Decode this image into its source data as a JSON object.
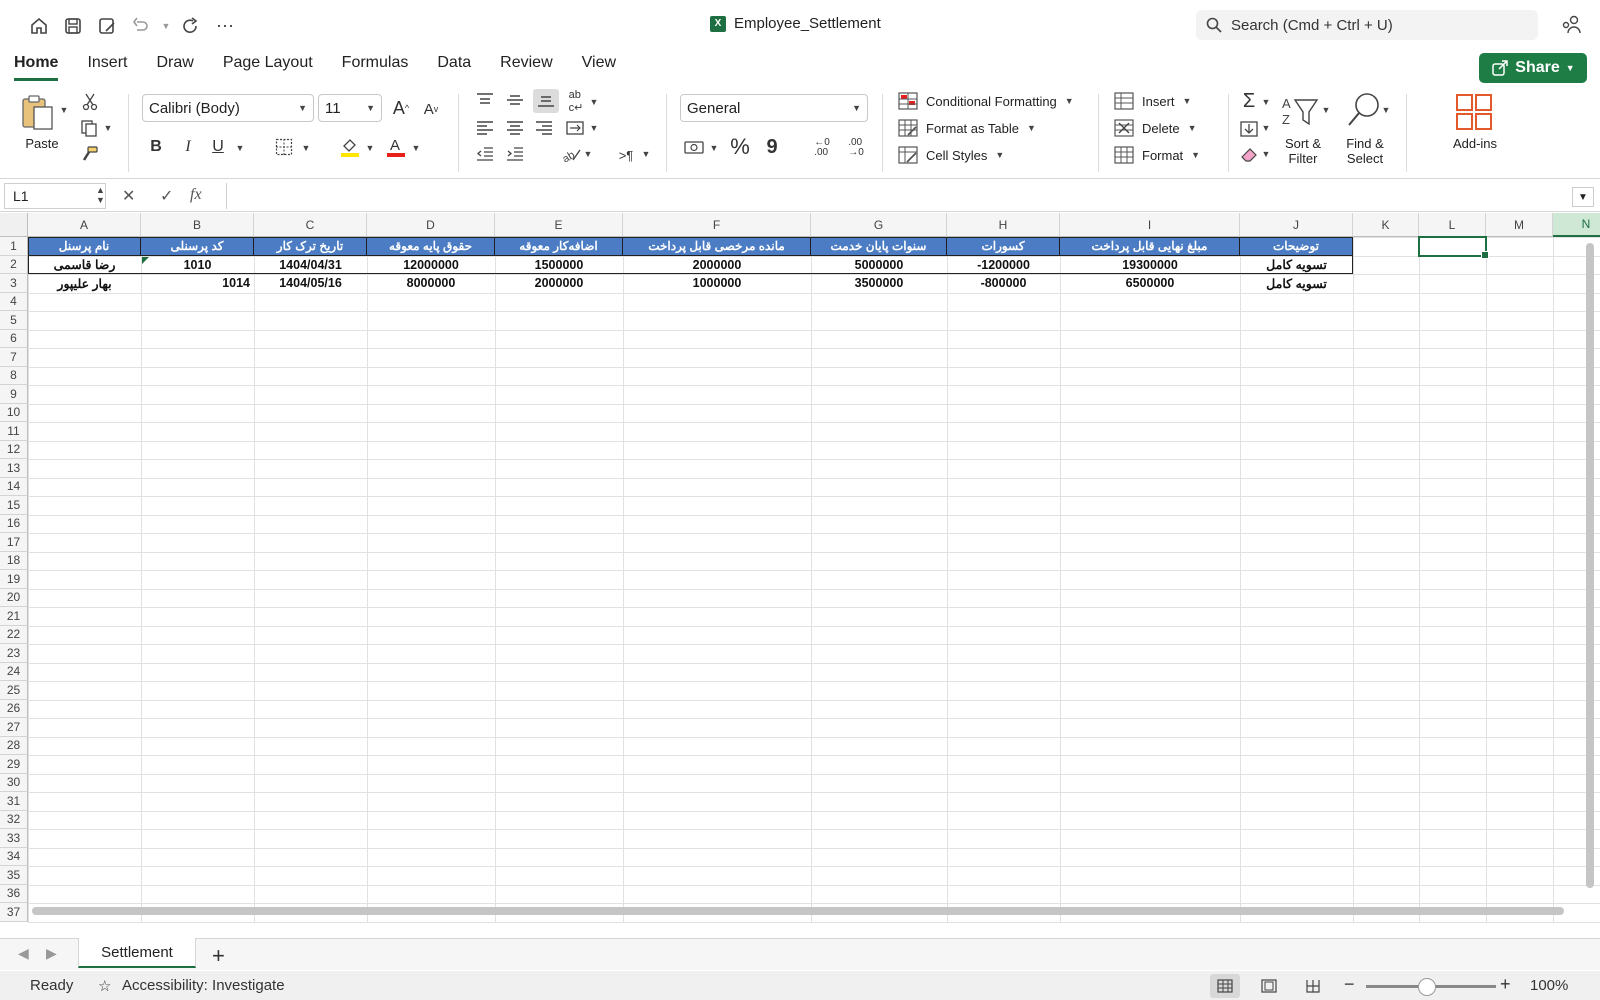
{
  "window": {
    "title": "Employee_Settlement",
    "search_placeholder": "Search (Cmd + Ctrl + U)"
  },
  "tabs": [
    "Home",
    "Insert",
    "Draw",
    "Page Layout",
    "Formulas",
    "Data",
    "Review",
    "View"
  ],
  "share_label": "Share",
  "ribbon": {
    "paste": "Paste",
    "font_name": "Calibri (Body)",
    "font_size": "11",
    "number_format": "General",
    "conditional_formatting": "Conditional Formatting",
    "format_as_table": "Format as Table",
    "cell_styles": "Cell Styles",
    "insert": "Insert",
    "delete": "Delete",
    "format": "Format",
    "sort_filter": "Sort & Filter",
    "find_select": "Find & Select",
    "addins": "Add-ins",
    "bold": "B",
    "italic": "I",
    "underline": "U",
    "percent": "%",
    "comma": "9"
  },
  "formula_bar": {
    "name_box": "L1",
    "formula": ""
  },
  "columns": [
    "A",
    "B",
    "C",
    "D",
    "E",
    "F",
    "G",
    "H",
    "I",
    "J",
    "K",
    "L",
    "M",
    "N"
  ],
  "rows": [
    "1",
    "2",
    "3",
    "4",
    "5",
    "6",
    "7",
    "8",
    "9",
    "10",
    "11",
    "12",
    "13",
    "14",
    "15",
    "16",
    "17",
    "18",
    "19",
    "20",
    "21",
    "22",
    "23",
    "24",
    "25",
    "26",
    "27",
    "28",
    "29",
    "30",
    "31",
    "32",
    "33",
    "34",
    "35",
    "36",
    "37"
  ],
  "table": {
    "headers": [
      "نام پرسنل",
      "کد پرسنلی",
      "تاریخ ترک کار",
      "حقوق پایه معوقه",
      "اضافه‌کار معوقه",
      "مانده مرخصی قابل پرداخت",
      "سنوات پایان خدمت",
      "کسورات",
      "مبلغ نهایی قابل پرداخت",
      "توضیحات"
    ],
    "rows": [
      [
        "رضا قاسمی",
        "1010",
        "1404/04/31",
        "12000000",
        "1500000",
        "2000000",
        "5000000",
        "-1200000",
        "19300000",
        "تسویه کامل"
      ],
      [
        "بهار علیپور",
        "1014",
        "1404/05/16",
        "8000000",
        "2000000",
        "1000000",
        "3500000",
        "-800000",
        "6500000",
        "تسویه کامل"
      ]
    ]
  },
  "sheet_tab": "Settlement",
  "status": {
    "ready": "Ready",
    "accessibility": "Accessibility: Investigate",
    "zoom": "100%"
  },
  "colors": {
    "accent": "#1d6f42",
    "header_fill": "#4b7cc4"
  }
}
